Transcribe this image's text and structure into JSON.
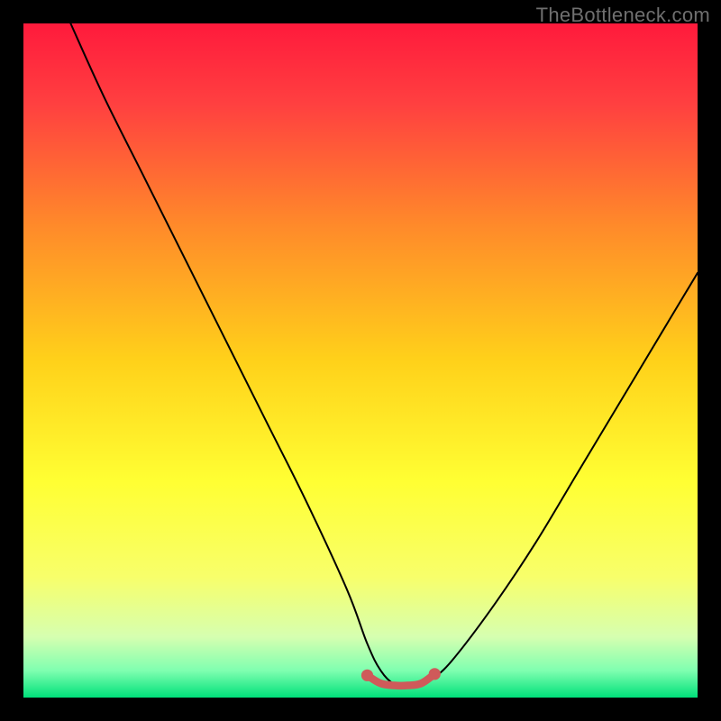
{
  "watermark": "TheBottleneck.com",
  "colors": {
    "gradient_stops": [
      "#ff1a3c",
      "#ff4040",
      "#ff8a2a",
      "#ffd11a",
      "#ffff33",
      "#f8ff6a",
      "#d6ffb0",
      "#7fffb0",
      "#00e07a"
    ],
    "curve": "#000000",
    "marker": "#cf5a5a",
    "marker_edge": "#cf5a5a",
    "background": "#000000"
  },
  "chart_data": {
    "type": "line",
    "title": "",
    "xlabel": "",
    "ylabel": "",
    "xlim": [
      0,
      100
    ],
    "ylim": [
      0,
      100
    ],
    "series": [
      {
        "name": "bottleneck-curve",
        "x": [
          7,
          12,
          18,
          24,
          30,
          36,
          42,
          48,
          51,
          53,
          55,
          57,
          59,
          61,
          64,
          70,
          76,
          82,
          88,
          94,
          100
        ],
        "y": [
          100,
          89,
          77,
          65,
          53,
          41,
          29,
          16,
          8,
          4,
          2,
          2,
          2,
          3,
          6,
          14,
          23,
          33,
          43,
          53,
          63
        ]
      },
      {
        "name": "flat-bottom-marker",
        "x": [
          51,
          53,
          55,
          57,
          59,
          61
        ],
        "y": [
          3.3,
          2.1,
          1.8,
          1.8,
          2.1,
          3.5
        ]
      }
    ],
    "annotations": []
  }
}
